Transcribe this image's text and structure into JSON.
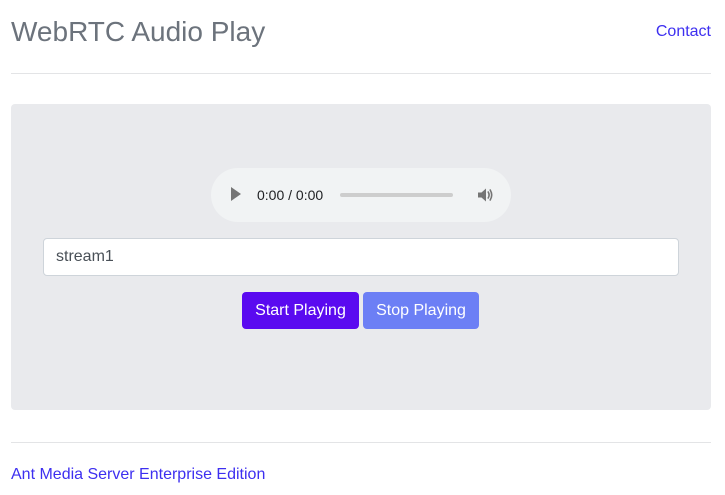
{
  "header": {
    "title": "WebRTC Audio Play",
    "contact_label": "Contact"
  },
  "player": {
    "play_icon": "play-icon",
    "current_time": "0:00",
    "separator": " / ",
    "total_time": "0:00",
    "progress": 0,
    "volume_icon": "volume-icon"
  },
  "stream": {
    "value": "stream1"
  },
  "controls": {
    "start_label": "Start Playing",
    "stop_label": "Stop Playing"
  },
  "footer": {
    "link_label": "Ant Media Server Enterprise Edition"
  },
  "colors": {
    "link": "#3d2ff0",
    "start_button": "#5a0af0",
    "stop_button": "#6c7ff5",
    "panel_background": "#e9eaed"
  }
}
